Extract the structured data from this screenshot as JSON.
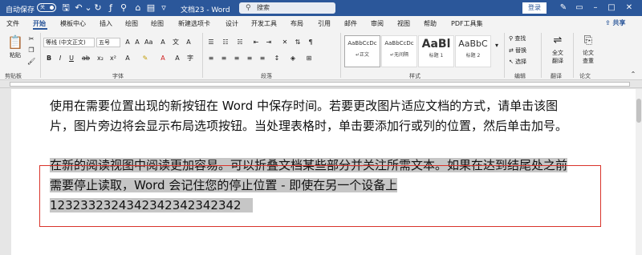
{
  "titlebar": {
    "autosave_label": "自动保存",
    "autosave_state": "关",
    "doc_title": "文档23 - Word",
    "search_placeholder": "搜索",
    "login_label": "登录"
  },
  "tabs": [
    {
      "label": "文件"
    },
    {
      "label": "开始"
    },
    {
      "label": "模板中心"
    },
    {
      "label": "插入"
    },
    {
      "label": "绘图"
    },
    {
      "label": "绘图"
    },
    {
      "label": "新建选项卡"
    },
    {
      "label": "设计"
    },
    {
      "label": "开发工具"
    },
    {
      "label": "布局"
    },
    {
      "label": "引用"
    },
    {
      "label": "邮件"
    },
    {
      "label": "审阅"
    },
    {
      "label": "视图"
    },
    {
      "label": "帮助"
    },
    {
      "label": "PDF工具集"
    }
  ],
  "active_tab": "开始",
  "share_label": "共享",
  "ribbon": {
    "clipboard": {
      "paste_label": "粘贴",
      "group_label": "剪贴板"
    },
    "font": {
      "font_name": "等线 (中文正文)",
      "font_size": "五号",
      "group_label": "字体"
    },
    "paragraph": {
      "group_label": "段落"
    },
    "styles": {
      "group_label": "样式",
      "items": [
        {
          "preview": "AaBbCcDc",
          "name": "↵正文"
        },
        {
          "preview": "AaBbCcDc",
          "name": "↵无间隔"
        },
        {
          "preview": "AaBl",
          "name": "标题 1"
        },
        {
          "preview": "AaBbC",
          "name": "标题 2"
        }
      ]
    },
    "editing": {
      "find": "查找",
      "replace": "替换",
      "select": "选择",
      "group_label": "编辑"
    },
    "translate": {
      "label1": "全文",
      "label2": "翻译",
      "group_label": "翻译"
    },
    "paper": {
      "label1": "论文",
      "label2": "查重",
      "group_label": "论文"
    }
  },
  "document": {
    "paragraph1": "使用在需要位置出现的新按钮在 Word 中保存时间。若要更改图片适应文档的方式，请单击该图片，图片旁边将会显示布局选项按钮。当处理表格时，单击要添加行或列的位置，然后单击加号。",
    "paragraph2_selected": "在新的阅读视图中阅读更加容易。可以折叠文档某些部分并关注所需文本。如果在达到结尾处之前需要停止读取，Word 会记住您的停止位置 - 即使在另一个设备上 12323323243",
    "paragraph2_tail": "42342342342342"
  },
  "colors": {
    "titlebar": "#2b579a",
    "selection": "#c6c6c6",
    "highlight_box": "#d9342b"
  }
}
